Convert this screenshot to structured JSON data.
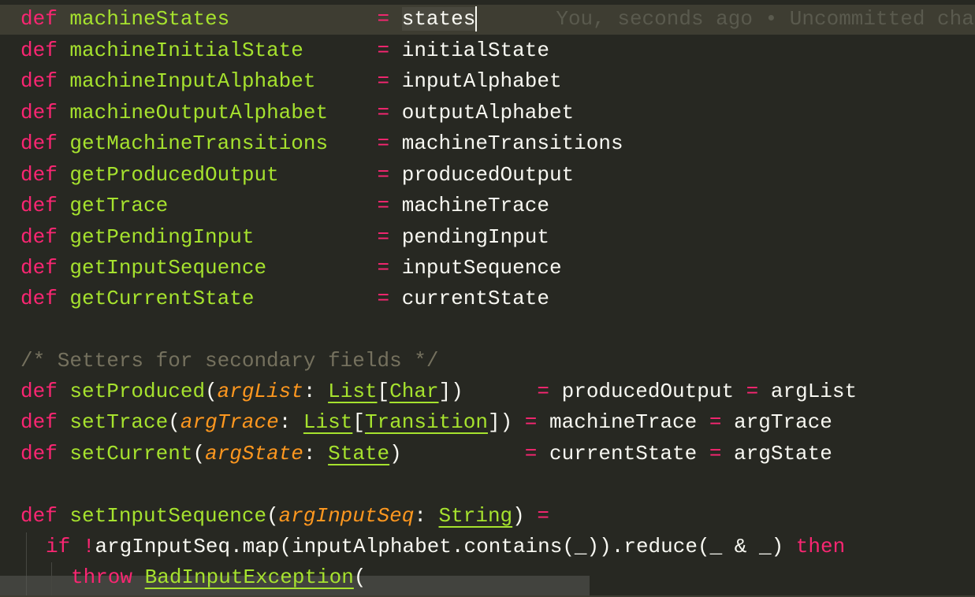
{
  "editor": {
    "blame_annotation": "You, seconds ago • Uncommitted chang",
    "lines": {
      "l1": {
        "kw": "def",
        "name": "machineStates",
        "pad": "            ",
        "eq": "=",
        "value": "states"
      },
      "l2": {
        "kw": "def",
        "name": "machineInitialState",
        "pad": "      ",
        "eq": "=",
        "value": "initialState"
      },
      "l3": {
        "kw": "def",
        "name": "machineInputAlphabet",
        "pad": "     ",
        "eq": "=",
        "value": "inputAlphabet"
      },
      "l4": {
        "kw": "def",
        "name": "machineOutputAlphabet",
        "pad": "    ",
        "eq": "=",
        "value": "outputAlphabet"
      },
      "l5": {
        "kw": "def",
        "name": "getMachineTransitions",
        "pad": "    ",
        "eq": "=",
        "value": "machineTransitions"
      },
      "l6": {
        "kw": "def",
        "name": "getProducedOutput",
        "pad": "        ",
        "eq": "=",
        "value": "producedOutput"
      },
      "l7": {
        "kw": "def",
        "name": "getTrace",
        "pad": "                 ",
        "eq": "=",
        "value": "machineTrace"
      },
      "l8": {
        "kw": "def",
        "name": "getPendingInput",
        "pad": "          ",
        "eq": "=",
        "value": "pendingInput"
      },
      "l9": {
        "kw": "def",
        "name": "getInputSequence",
        "pad": "         ",
        "eq": "=",
        "value": "inputSequence"
      },
      "l10": {
        "kw": "def",
        "name": "getCurrentState",
        "pad": "          ",
        "eq": "=",
        "value": "currentState"
      },
      "comment": "/* Setters for secondary fields */",
      "s1": {
        "kw": "def",
        "name": "setProduced",
        "open": "(",
        "param": "argList",
        "colon": ": ",
        "type1": "List",
        "lb": "[",
        "type2": "Char",
        "rb": "]",
        "close": ")",
        "pad": "      ",
        "eq1": "=",
        "field": "producedOutput",
        "eq2": "=",
        "arg": "argList"
      },
      "s2": {
        "kw": "def",
        "name": "setTrace",
        "open": "(",
        "param": "argTrace",
        "colon": ": ",
        "type1": "List",
        "lb": "[",
        "type2": "Transition",
        "rb": "]",
        "close": ")",
        "pad": " ",
        "eq1": "=",
        "field": "machineTrace",
        "eq2": "=",
        "arg": "argTrace"
      },
      "s3": {
        "kw": "def",
        "name": "setCurrent",
        "open": "(",
        "param": "argState",
        "colon": ": ",
        "type1": "State",
        "close": ")",
        "pad": "          ",
        "eq1": "=",
        "field": "currentState",
        "eq2": "=",
        "arg": "argState"
      },
      "f1": {
        "kw": "def",
        "name": "setInputSequence",
        "open": "(",
        "param": "argInputSeq",
        "colon": ": ",
        "type1": "String",
        "close": ")",
        "eq": "="
      },
      "f2": {
        "kw_if": "if",
        "bang": "!",
        "expr": "argInputSeq.map(inputAlphabet.contains(_)).reduce(_ & _)",
        "kw_then": "then"
      },
      "f3": {
        "kw_throw": "throw",
        "type": "BadInputException",
        "open": "("
      }
    }
  },
  "colors": {
    "background": "#272822",
    "keyword": "#f92672",
    "function": "#a6e22e",
    "parameter": "#fd971f",
    "comment": "#75715e",
    "text": "#f8f8f2",
    "current_line": "#3e3d32",
    "selection": "#49483e"
  }
}
